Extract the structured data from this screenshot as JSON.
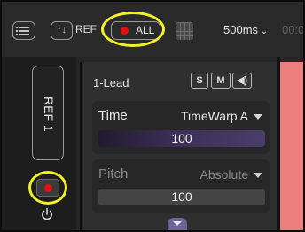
{
  "toolbar": {
    "ref_mode_glyph": "↑↓",
    "ref_label": "REF",
    "record_all_label": "ALL",
    "interval_label": "500ms",
    "timecode": "00:0"
  },
  "track": {
    "ref_button_label": "REF 1",
    "colors": {
      "record": "#e61010",
      "highlight": "#f4ef28",
      "clip": "#ec7e7e"
    }
  },
  "panel": {
    "title": "1-Lead",
    "solo_label": "S",
    "mute_label": "M",
    "speaker_glyph": "◀)",
    "time": {
      "label": "Time",
      "mode": "TimeWarp A",
      "value": "100"
    },
    "pitch": {
      "label": "Pitch",
      "mode": "Absolute",
      "value": "100"
    }
  },
  "icons": [
    "list-icon",
    "ref-mode-icon",
    "record-dot-icon",
    "grid-icon",
    "chevron-down-icon",
    "power-icon",
    "speaker-icon",
    "expand-arrow-icon"
  ]
}
